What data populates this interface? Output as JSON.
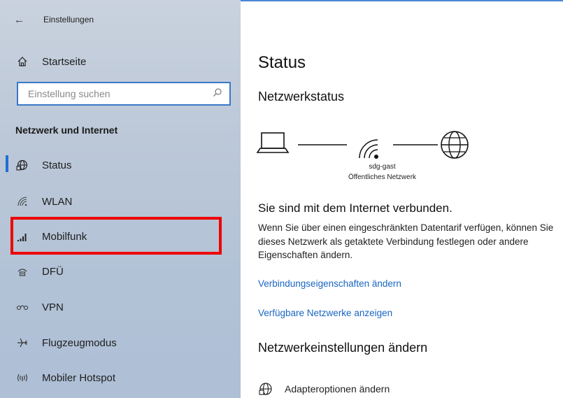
{
  "titlebar": {
    "back_icon": "back-arrow-icon",
    "title": "Einstellungen"
  },
  "sidebar": {
    "home_label": "Startseite",
    "search_placeholder": "Einstellung suchen",
    "section_title": "Netzwerk und Internet",
    "items": [
      {
        "label": "Status",
        "icon": "network-status-icon",
        "active": true
      },
      {
        "label": "WLAN",
        "icon": "wifi-icon"
      },
      {
        "label": "Mobilfunk",
        "icon": "cellular-signal-icon"
      },
      {
        "label": "DFÜ",
        "icon": "dialup-icon"
      },
      {
        "label": "VPN",
        "icon": "vpn-icon"
      },
      {
        "label": "Flugzeugmodus",
        "icon": "airplane-icon"
      },
      {
        "label": "Mobiler Hotspot",
        "icon": "hotspot-icon"
      }
    ]
  },
  "main": {
    "title": "Status",
    "network_status_heading": "Netzwerkstatus",
    "network_name": "sdg-gast",
    "network_type": "Öffentliches Netzwerk",
    "connected_text": "Sie sind mit dem Internet verbunden.",
    "description": "Wenn Sie über einen eingeschränkten Datentarif verfügen, können Sie dieses Netzwerk als getaktete Verbindung festlegen oder andere Eigenschaften ändern.",
    "link_properties": "Verbindungseigenschaften ändern",
    "link_networks": "Verfügbare Netzwerke anzeigen",
    "change_settings_heading": "Netzwerkeinstellungen ändern",
    "adapter_options": "Adapteroptionen ändern"
  },
  "colors": {
    "accent": "#1f6fd1",
    "link": "#1a66c2",
    "highlight": "#ee0000",
    "sidebar_bg": "#bcc8d8"
  }
}
